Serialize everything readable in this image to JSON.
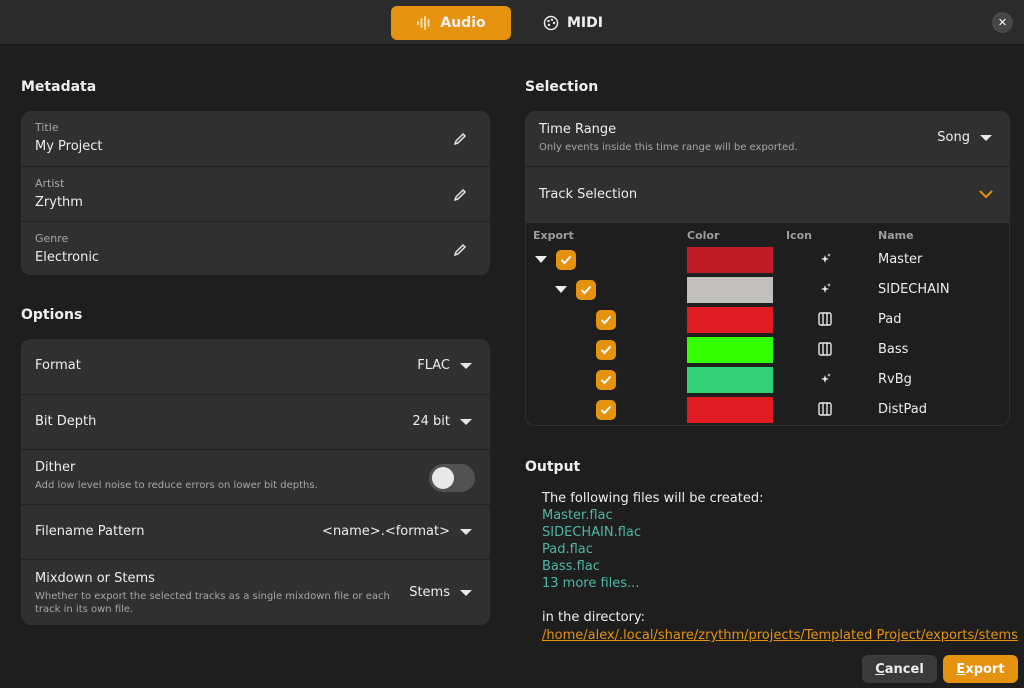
{
  "header": {
    "tabs": [
      {
        "label": "Audio",
        "icon": "waveform-icon",
        "active": true
      },
      {
        "label": "MIDI",
        "icon": "palette-icon",
        "active": false
      }
    ],
    "close_icon": "close-icon"
  },
  "metadata": {
    "heading": "Metadata",
    "fields": [
      {
        "label": "Title",
        "value": "My Project"
      },
      {
        "label": "Artist",
        "value": "Zrythm"
      },
      {
        "label": "Genre",
        "value": "Electronic"
      }
    ]
  },
  "options": {
    "heading": "Options",
    "format": {
      "label": "Format",
      "value": "FLAC"
    },
    "bit_depth": {
      "label": "Bit Depth",
      "value": "24 bit"
    },
    "dither": {
      "label": "Dither",
      "subtitle": "Add low level noise to reduce errors on lower bit depths.",
      "enabled": false
    },
    "filename_pattern": {
      "label": "Filename Pattern",
      "value": "<name>.<format>"
    },
    "mixdown": {
      "label": "Mixdown or Stems",
      "subtitle": "Whether to export the selected tracks as a single mixdown file or each track in its own file.",
      "value": "Stems"
    }
  },
  "selection": {
    "heading": "Selection",
    "time_range": {
      "label": "Time Range",
      "subtitle": "Only events inside this time range will be exported.",
      "value": "Song"
    },
    "track_selection": {
      "label": "Track Selection"
    },
    "columns": [
      "Export",
      "Color",
      "Icon",
      "Name"
    ],
    "tracks": [
      {
        "name": "Master",
        "color": "#c01c28",
        "icon": "sparkle-icon",
        "checked": true
      },
      {
        "name": "SIDECHAIN",
        "color": "#c0bfbc",
        "icon": "sparkle-icon",
        "checked": true
      },
      {
        "name": "Pad",
        "color": "#e01b24",
        "icon": "piano-icon",
        "checked": true
      },
      {
        "name": "Bass",
        "color": "#33ff00",
        "icon": "piano-icon",
        "checked": true
      },
      {
        "name": "RvBg",
        "color": "#33d17a",
        "icon": "sparkle-icon",
        "checked": true
      },
      {
        "name": "DistPad",
        "color": "#e01b24",
        "icon": "piano-icon",
        "checked": true
      }
    ]
  },
  "output": {
    "heading": "Output",
    "intro": "The following files will be created:",
    "files": [
      "Master.flac",
      "SIDECHAIN.flac",
      "Pad.flac",
      "Bass.flac",
      "13 more files..."
    ],
    "dir_label": "in the directory:",
    "directory": "/home/alex/.local/share/zrythm/projects/Templated Project/exports/stems"
  },
  "buttons": {
    "cancel_initial": "C",
    "cancel_rest": "ancel",
    "export_initial": "E",
    "export_rest": "xport"
  },
  "colors": {
    "accent": "#e5920f",
    "link": "#4fb6a7"
  }
}
